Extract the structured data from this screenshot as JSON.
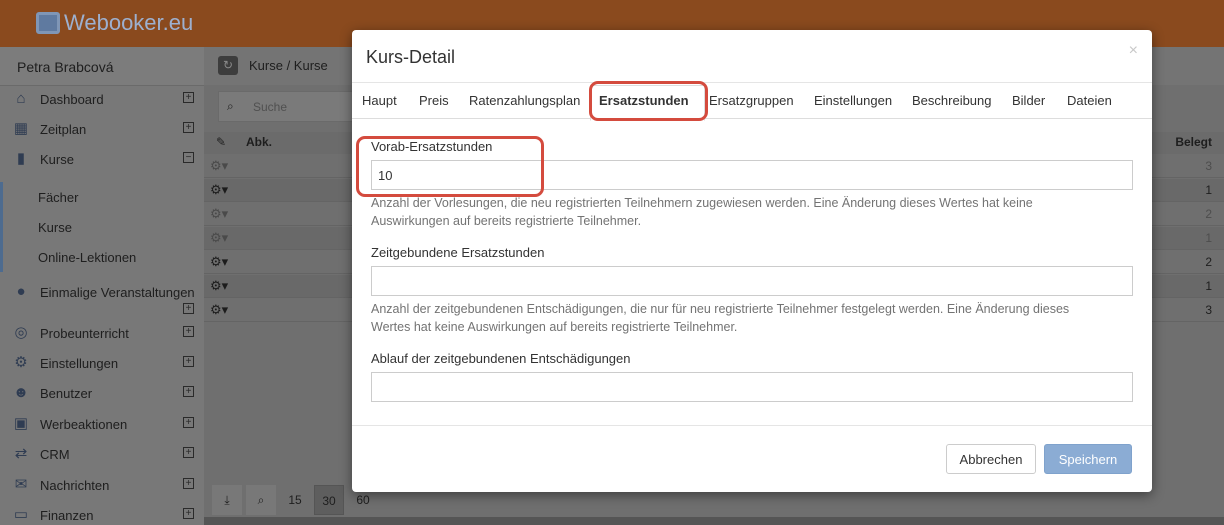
{
  "app": {
    "logo_text": "Webooker.eu",
    "logo_icon": "calendar-icon"
  },
  "sidebar": {
    "user": "Petra Brabcová",
    "items": [
      {
        "label": "Dashboard",
        "icon": "home-icon",
        "toggle": "⊞"
      },
      {
        "label": "Zeitplan",
        "icon": "calendar-icon",
        "toggle": "⊞"
      },
      {
        "label": "Kurse",
        "icon": "book-icon",
        "toggle": "⊟"
      },
      {
        "label": "Einmalige Veranstaltungen",
        "icon": "ball-icon",
        "toggle": "⊞"
      },
      {
        "label": "Probeunterricht",
        "icon": "eye-icon",
        "toggle": "⊞"
      },
      {
        "label": "Einstellungen",
        "icon": "gear-icon",
        "toggle": "⊞"
      },
      {
        "label": "Benutzer",
        "icon": "users-icon",
        "toggle": "⊞"
      },
      {
        "label": "Werbeaktionen",
        "icon": "gift-icon",
        "toggle": "⊞"
      },
      {
        "label": "CRM",
        "icon": "handshake-icon",
        "toggle": "⊞"
      },
      {
        "label": "Nachrichten",
        "icon": "envelope-icon",
        "toggle": "⊞"
      },
      {
        "label": "Finanzen",
        "icon": "money-icon",
        "toggle": "⊞"
      }
    ],
    "subitems": [
      "Fächer",
      "Kurse",
      "Online-Lektionen"
    ]
  },
  "main": {
    "breadcrumb": "Kurse / Kurse",
    "search_placeholder": "Suche",
    "columns": {
      "abk": "Abk.",
      "belegt": "Belegt"
    },
    "rows": [
      "3",
      "1",
      "2",
      "1",
      "2",
      "1",
      "3"
    ],
    "pager": [
      "15",
      "30",
      "60"
    ]
  },
  "modal": {
    "title": "Kurs-Detail",
    "close": "×",
    "tabs": [
      "Haupt",
      "Preis",
      "Ratenzahlungsplan",
      "Ersatzstunden",
      "Ersatzgruppen",
      "Einstellungen",
      "Beschreibung",
      "Bilder",
      "Dateien"
    ],
    "active_tab": "Ersatzstunden",
    "fields": [
      {
        "label": "Vorab-Ersatzstunden",
        "value": "10",
        "help": "Anzahl der Vorlesungen, die neu registrierten Teilnehmern zugewiesen werden. Eine Änderung dieses Wertes hat keine Auswirkungen auf bereits registrierte Teilnehmer."
      },
      {
        "label": "Zeitgebundene Ersatzstunden",
        "value": "",
        "help": "Anzahl der zeitgebundenen Entschädigungen, die nur für neu registrierte Teilnehmer festgelegt werden. Eine Änderung dieses Wertes hat keine Auswirkungen auf bereits registrierte Teilnehmer."
      },
      {
        "label": "Ablauf der zeitgebundenen Entschädigungen",
        "value": ""
      }
    ],
    "cancel": "Abbrechen",
    "save": "Speichern"
  },
  "colors": {
    "topbar": "#8a4a1e",
    "highlight": "#d44b3e",
    "save_button": "#8bacd4"
  }
}
